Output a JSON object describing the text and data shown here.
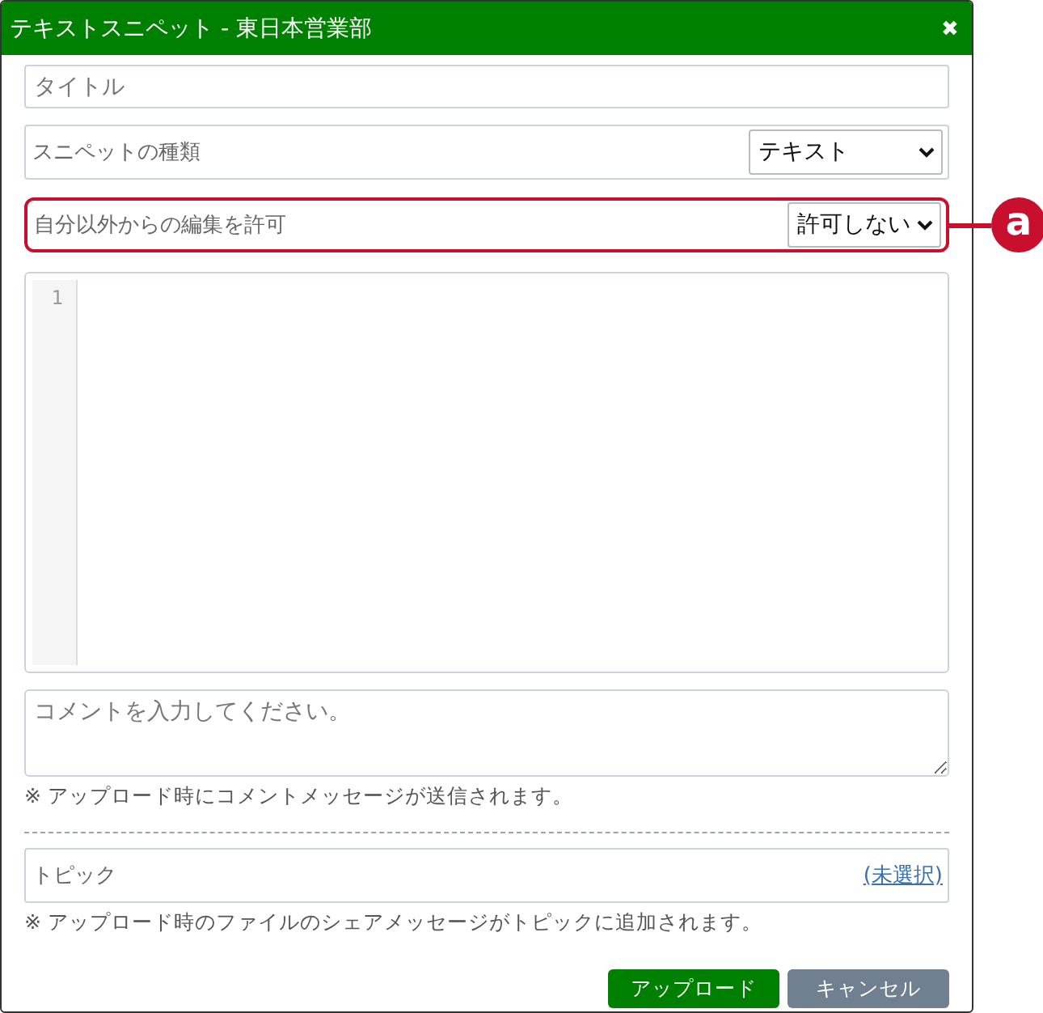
{
  "window": {
    "title": "テキストスニペット - 東日本営業部",
    "close_icon": "✖"
  },
  "title_field": {
    "placeholder": "タイトル"
  },
  "snippet_type": {
    "label": "スニペットの種類",
    "value": "テキスト"
  },
  "edit_permission": {
    "label": "自分以外からの編集を許可",
    "value": "許可しない",
    "highlighted": true
  },
  "callout": {
    "label": "a"
  },
  "editor": {
    "line_numbers": [
      "1"
    ]
  },
  "comment": {
    "placeholder": "コメントを入力してください。",
    "note": "※ アップロード時にコメントメッセージが送信されます。"
  },
  "topic": {
    "label": "トピック",
    "link": "(未選択)",
    "note": "※ アップロード時のファイルのシェアメッセージがトピックに追加されます。"
  },
  "buttons": [
    {
      "label": "アップロード",
      "kind": "primary"
    },
    {
      "label": "キャンセル",
      "kind": "secondary"
    }
  ]
}
